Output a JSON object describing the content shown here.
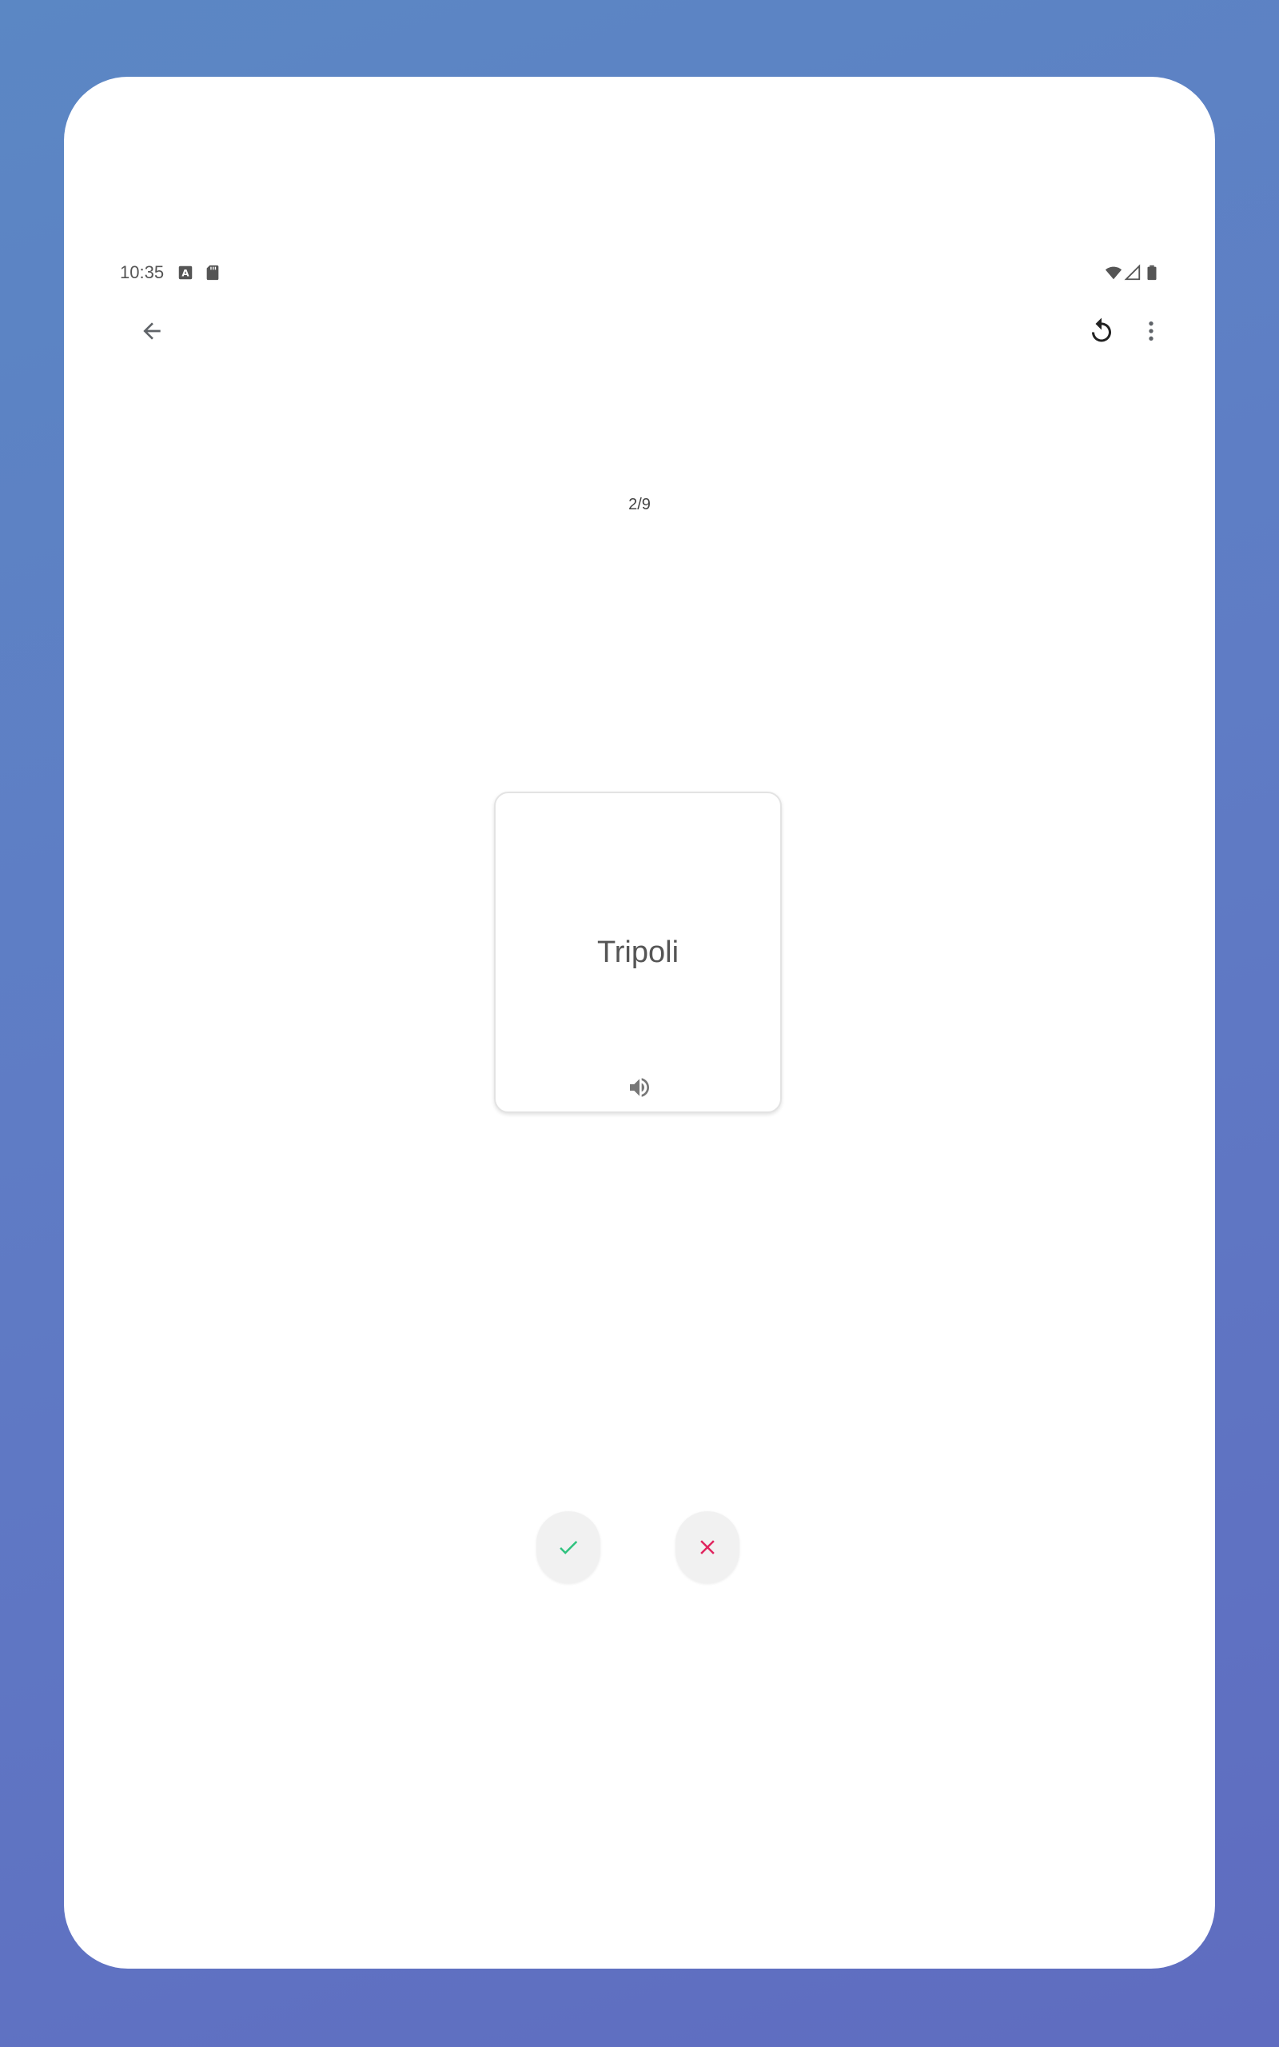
{
  "status_bar": {
    "time": "10:35",
    "left_icons": [
      "a-icon",
      "sd-card-icon"
    ],
    "right_icons": [
      "wifi-icon",
      "signal-icon",
      "battery-icon"
    ]
  },
  "app_bar": {
    "back_icon": "arrow-back-icon",
    "actions": [
      "refresh-icon",
      "more-vert-icon"
    ]
  },
  "progress": {
    "text": "2/9"
  },
  "card": {
    "word": "Tripoli",
    "audio_icon": "speaker-icon"
  },
  "answers": {
    "correct_icon": "check-icon",
    "wrong_icon": "close-icon",
    "colors": {
      "correct": "#2ec27e",
      "wrong": "#e0245e"
    }
  }
}
